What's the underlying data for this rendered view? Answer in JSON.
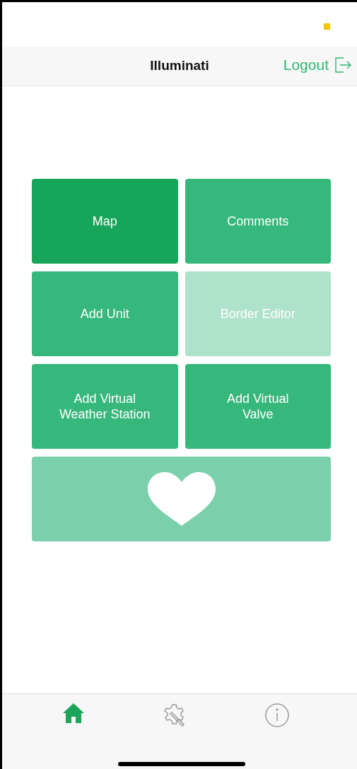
{
  "nav_bar": {
    "title": "Illuminati",
    "logout": "Logout"
  },
  "tiles": [
    {
      "kind": "text",
      "label": "Map",
      "selected": true,
      "disabled": false
    },
    {
      "kind": "text",
      "label": "Comments",
      "selected": false,
      "disabled": false
    },
    {
      "kind": "text",
      "label": "Add Unit",
      "selected": false,
      "disabled": false
    },
    {
      "kind": "text",
      "label": "Border Editor",
      "selected": false,
      "disabled": true
    },
    {
      "kind": "text",
      "label": "Add Virtual\nWeather Station",
      "selected": false,
      "disabled": false
    },
    {
      "kind": "text",
      "label": "Add Virtual\nValve",
      "selected": false,
      "disabled": false
    },
    {
      "kind": "heart",
      "selected": false,
      "disabled": false
    }
  ],
  "tab_bar": [
    {
      "kind": "home",
      "selected": true
    },
    {
      "kind": "tools",
      "selected": false
    },
    {
      "kind": "info",
      "selected": false
    }
  ]
}
